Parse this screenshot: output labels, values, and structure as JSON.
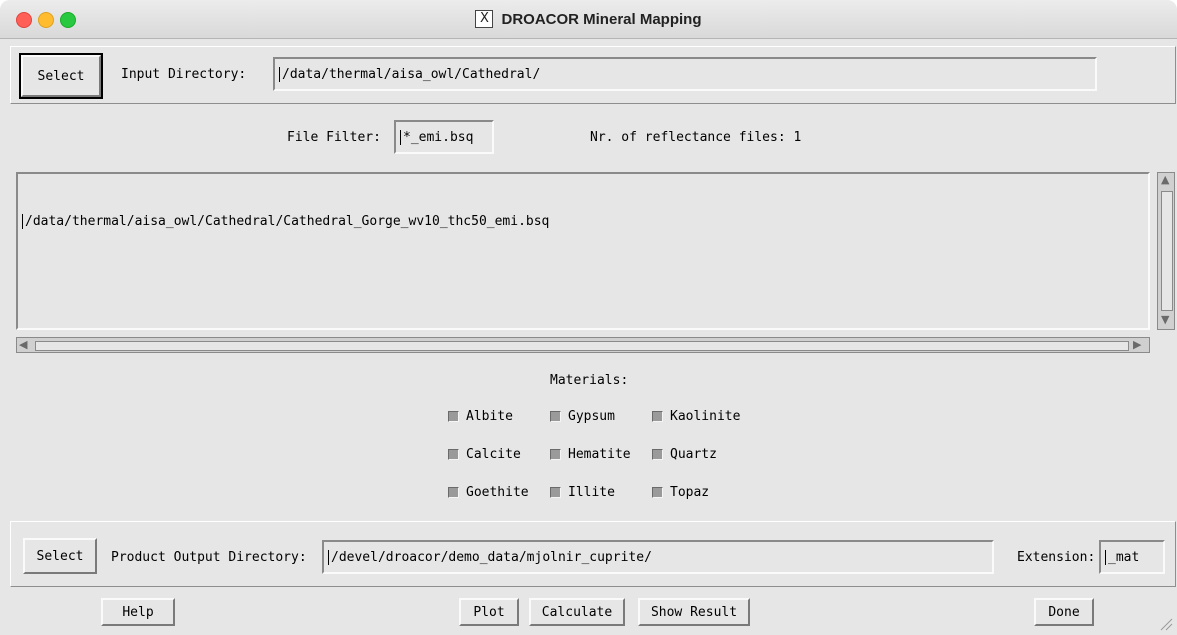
{
  "window": {
    "title": "DROACOR Mineral Mapping",
    "x_glyph": "X"
  },
  "input": {
    "select_label": "Select",
    "dir_label": "Input Directory:",
    "dir_value": "/data/thermal/aisa_owl/Cathedral/",
    "filter_label": "File Filter:",
    "filter_value": "*_emi.bsq",
    "count_text": "Nr. of reflectance files: 1",
    "files": [
      "/data/thermal/aisa_owl/Cathedral/Cathedral_Gorge_wv10_thc50_emi.bsq"
    ]
  },
  "materials": {
    "heading": "Materials:",
    "items": [
      [
        "Albite",
        "Gypsum",
        "Kaolinite"
      ],
      [
        "Calcite",
        "Hematite",
        "Quartz"
      ],
      [
        "Goethite",
        "Illite",
        "Topaz"
      ]
    ]
  },
  "output": {
    "select_label": "Select",
    "dir_label": "Product Output Directory:",
    "dir_value": "/devel/droacor/demo_data/mjolnir_cuprite/",
    "ext_label": "Extension:",
    "ext_value": "_mat"
  },
  "buttons": {
    "help": "Help",
    "plot": "Plot",
    "calculate": "Calculate",
    "show_result": "Show Result",
    "done": "Done"
  }
}
